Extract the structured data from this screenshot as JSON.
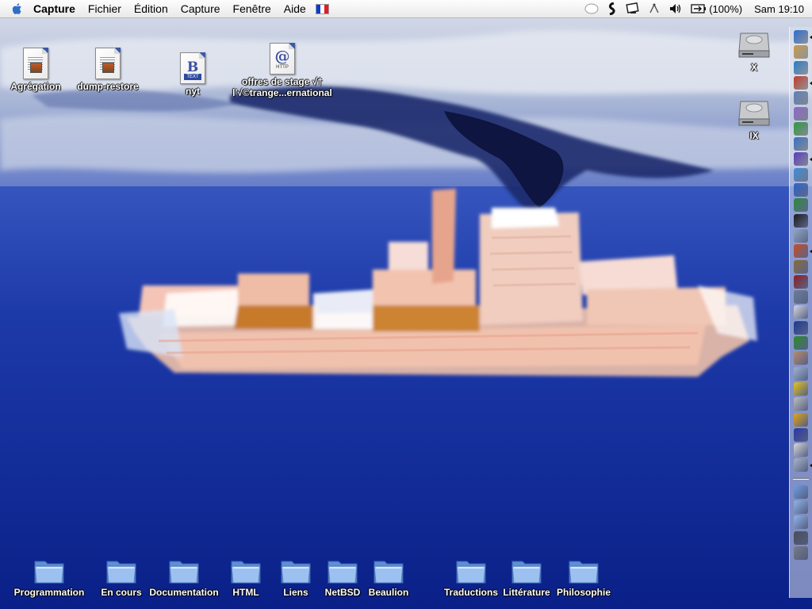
{
  "menubar": {
    "app_name": "Capture",
    "menus": [
      "Fichier",
      "Édition",
      "Capture",
      "Fenêtre",
      "Aide"
    ],
    "flag_colors": [
      "#0d3ccc",
      "#ffffff",
      "#e31b23"
    ],
    "status_icons": [
      "status-indicator-icon",
      "scripts-icon",
      "display-icon",
      "modem-icon",
      "volume-icon",
      "battery-icon"
    ],
    "battery": "(100%)",
    "clock": "Sam 19:10"
  },
  "desktop_icons": [
    {
      "label": "Agrégation",
      "icon": "text-document-icon"
    },
    {
      "label": "dump-restore",
      "icon": "text-document-icon"
    },
    {
      "label": "nyt",
      "icon": "bbedit-text-icon"
    },
    {
      "label_line1": "offres de stage √†",
      "label_line2": "l'√©trange...ernational",
      "icon": "http-location-icon"
    }
  ],
  "drives": [
    {
      "label": "X",
      "icon": "hard-drive-icon"
    },
    {
      "label": "IX",
      "icon": "hard-drive-icon"
    }
  ],
  "folders": [
    {
      "label": "Programmation"
    },
    {
      "label": "En cours"
    },
    {
      "label": "Documentation"
    },
    {
      "label": "HTML"
    },
    {
      "label": "Liens"
    },
    {
      "label": "NetBSD"
    },
    {
      "label": "Beaulion"
    },
    {
      "label": "Traductions"
    },
    {
      "label": "Littérature"
    },
    {
      "label": "Philosophie"
    }
  ],
  "dock_icons": [
    "finder-icon",
    "address-book-icon",
    "notes-icon",
    "ical-icon",
    "app-icon",
    "itunes-icon",
    "ichat-icon",
    "messenger-icon",
    "mozilla-icon",
    "sync-icon",
    "internet-explorer-icon",
    "network-globe-icon",
    "terminal-icon",
    "preview-icon",
    "html-editor-icon",
    "dictionary-icon",
    "book-icon",
    "text-editor-icon",
    "font-book-icon",
    "bbedit-icon",
    "pen-tool-icon",
    "user-icon",
    "clouds-icon",
    "sunflower-icon",
    "printer-icon",
    "warning-icon",
    "eye-icon",
    "letters-icon",
    "image-icon",
    "folder-icon",
    "documents-icon",
    "downloads-icon",
    "server-icon",
    "trash-icon"
  ],
  "colors": {
    "sky": "#c9d3e8",
    "sea": "#0c2792",
    "menubar": "#f2f2f2",
    "label_text": "#ffffff",
    "folder_blue": "#8fb6ea"
  }
}
